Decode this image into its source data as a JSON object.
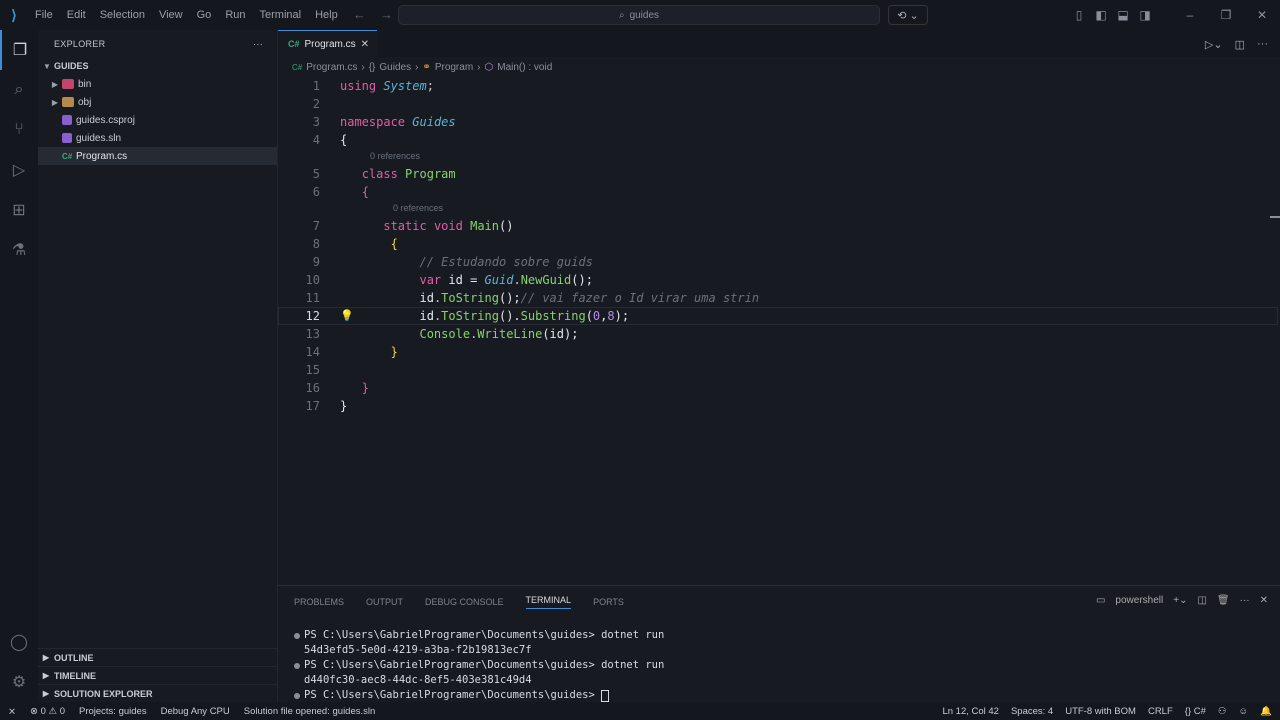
{
  "menu": [
    "File",
    "Edit",
    "Selection",
    "View",
    "Go",
    "Run",
    "Terminal",
    "Help"
  ],
  "command_center": "guides",
  "explorer": {
    "title": "EXPLORER",
    "root": "GUIDES",
    "items": [
      {
        "label": "bin",
        "kind": "folder-bin"
      },
      {
        "label": "obj",
        "kind": "folder"
      },
      {
        "label": "guides.csproj",
        "kind": "csproj"
      },
      {
        "label": "guides.sln",
        "kind": "sln"
      },
      {
        "label": "Program.cs",
        "kind": "cs"
      }
    ],
    "bottom": [
      "OUTLINE",
      "TIMELINE",
      "SOLUTION EXPLORER"
    ]
  },
  "tab": {
    "label": "Program.cs",
    "icon": "C#"
  },
  "breadcrumb": {
    "file": "Program.cs",
    "namespace": "Guides",
    "class": "Program",
    "method": "Main() : void"
  },
  "code": {
    "l1a": "using",
    "l1b": "System",
    "l1c": ";",
    "l3a": "namespace",
    "l3b": "Guides",
    "l4": "{",
    "lens1": "0 references",
    "l5a": "class",
    "l5b": "Program",
    "l6": "{",
    "lens2": "0 references",
    "l7a": "static",
    "l7b": "void",
    "l7c": "Main",
    "l7d": "()",
    "l8": "{",
    "l9": "// Estudando sobre guids",
    "l10a": "var",
    "l10b": "id",
    "l10c": " = ",
    "l10d": "Guid",
    "l10e": ".",
    "l10f": "NewGuid",
    "l10g": "();",
    "l11a": "id",
    "l11b": ".",
    "l11c": "ToString",
    "l11d": "();",
    "l11e": "// vai fazer o Id virar uma strin",
    "l12a": "id",
    "l12b": ".",
    "l12c": "ToString",
    "l12d": "().",
    "l12e": "Substring",
    "l12f": "(",
    "l12g": "0",
    "l12h": ",",
    "l12i": "8",
    "l12j": ");",
    "l13a": "Console",
    "l13b": ".",
    "l13c": "WriteLine",
    "l13d": "(id);",
    "l14": "}",
    "l16": "}",
    "l17": "}"
  },
  "line_numbers": [
    "1",
    "2",
    "3",
    "4",
    "5",
    "6",
    "7",
    "8",
    "9",
    "10",
    "11",
    "12",
    "13",
    "14",
    "15",
    "16",
    "17"
  ],
  "panel": {
    "tabs": [
      "PROBLEMS",
      "OUTPUT",
      "DEBUG CONSOLE",
      "TERMINAL",
      "PORTS"
    ],
    "active_tab": "TERMINAL",
    "shell": "powershell",
    "terminal": [
      "PS C:\\Users\\GabrielProgramer\\Documents\\guides> dotnet run",
      "54d3efd5-5e0d-4219-a3ba-f2b19813ec7f",
      "PS C:\\Users\\GabrielProgramer\\Documents\\guides> dotnet run",
      "d440fc30-aec8-44dc-8ef5-403e381c49d4",
      "PS C:\\Users\\GabrielProgramer\\Documents\\guides> "
    ]
  },
  "status": {
    "errors": "0",
    "warnings": "0",
    "projects": "Projects: guides",
    "debug": "Debug Any CPU",
    "solution": "Solution file opened: guides.sln",
    "position": "Ln 12, Col 42",
    "spaces": "Spaces: 4",
    "encoding": "UTF-8 with BOM",
    "eol": "CRLF",
    "language": "C#"
  }
}
